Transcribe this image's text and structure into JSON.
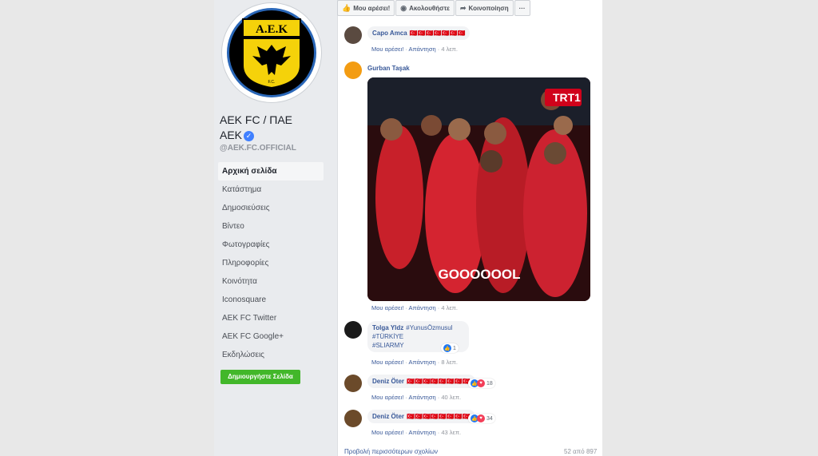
{
  "page": {
    "name": "AEK FC / ΠΑΕ AEK",
    "name_line1": "AEK FC / ΠΑΕ",
    "name_line2": "AEK",
    "handle": "@AEK.FC.OFFICIAL",
    "logo_text": "Α.Ε.Κ",
    "logo_sub": "F.C."
  },
  "sidebar": {
    "items": [
      {
        "label": "Αρχική σελίδα",
        "active": true
      },
      {
        "label": "Κατάστημα"
      },
      {
        "label": "Δημοσιεύσεις"
      },
      {
        "label": "Βίντεο"
      },
      {
        "label": "Φωτογραφίες"
      },
      {
        "label": "Πληροφορίες"
      },
      {
        "label": "Κοινότητα"
      },
      {
        "label": "Iconosquare"
      },
      {
        "label": "AEK FC Twitter"
      },
      {
        "label": "AEK FC Google+"
      },
      {
        "label": "Εκδηλώσεις"
      }
    ],
    "create_page": "Δημιουργήστε Σελίδα"
  },
  "actions": {
    "like": "Μου αρέσει!",
    "follow": "Ακολουθήστε",
    "share": "Κοινοποίηση",
    "more": "···"
  },
  "comments": [
    {
      "author": "Capo Amca",
      "text": "🇹🇷🇹🇷🇹🇷🇹🇷🇹🇷🇹🇷🇹🇷",
      "like": "Μου αρέσει!",
      "reply": "Απάντηση",
      "time": "4 λεπ."
    },
    {
      "author": "Gurban Taşak",
      "like": "Μου αρέσει!",
      "reply": "Απάντηση",
      "time": "4 λεπ.",
      "photo": {
        "badge": "TRT",
        "badge_num": "1",
        "caption": "GOOOOOOL"
      }
    },
    {
      "author": "Tolga Yldz",
      "mention": "#YunusÖzmusul",
      "line2": "#TÜRKİYE",
      "line3": "#SLIARMY",
      "like": "Μου αρέσει!",
      "reply": "Απάντηση",
      "time": "8 λεπ.",
      "reactions": "1"
    },
    {
      "author": "Deniz Öter",
      "text": "🇹🇷🇹🇷🇹🇷🇹🇷🇹🇷🇹🇷🇹🇷🇹🇷",
      "like": "Μου αρέσει!",
      "reply": "Απάντηση",
      "time": "40 λεπ.",
      "reactions": "18"
    },
    {
      "author": "Deniz Öter",
      "text": "🇹🇷🇹🇷🇹🇷🇹🇷🇹🇷🇹🇷🇹🇷🇹🇷",
      "like": "Μου αρέσει!",
      "reply": "Απάντηση",
      "time": "43 λεπ.",
      "reactions": "34"
    }
  ],
  "footer": {
    "more_comments": "Προβολή περισσότερων σχολίων",
    "count": "52 από 897"
  },
  "colors": {
    "link": "#385898",
    "create_button": "#42b72a",
    "logo_yellow": "#f5d20a",
    "ring_blue": "#2a67b8"
  }
}
